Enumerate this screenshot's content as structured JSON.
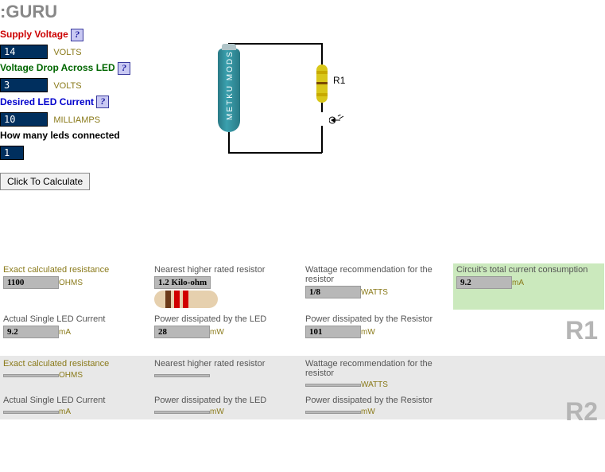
{
  "title": ":GURU",
  "inputs": {
    "supply_label": "Supply Voltage",
    "supply_value": "14",
    "supply_unit": "VOLTS",
    "vdrop_label": "Voltage Drop Across LED",
    "vdrop_value": "3",
    "vdrop_unit": "VOLTS",
    "current_label": "Desired LED Current",
    "current_value": "10",
    "current_unit": "MILLIAMPS",
    "count_label": "How many leds connected",
    "count_value": "1"
  },
  "calc_button": "Click To Calculate",
  "diagram": {
    "r1_label": "R1",
    "battery_text": "METKU MODS"
  },
  "results": {
    "r1": {
      "exact_label": "Exact calculated resistance",
      "exact_value": "1100",
      "exact_unit": "OHMS",
      "nearest_label": "Nearest higher rated resistor",
      "nearest_value": "1.2 Kilo-ohm",
      "watt_label": "Wattage recommendation for the resistor",
      "watt_value": "1/8",
      "watt_unit": "WATTS",
      "total_label": "Circuit's total current consumption",
      "total_value": "9.2",
      "total_unit": "mA",
      "actual_label": "Actual Single LED Current",
      "actual_value": "9.2",
      "actual_unit": "mA",
      "pled_label": "Power dissipated by the LED",
      "pled_value": "28",
      "pled_unit": "mW",
      "pres_label": "Power dissipated by the Resistor",
      "pres_value": "101",
      "pres_unit": "mW",
      "tag": "R1"
    },
    "r2": {
      "exact_label": "Exact calculated resistance",
      "exact_value": "",
      "exact_unit": "OHMS",
      "nearest_label": "Nearest higher rated resistor",
      "nearest_value": "",
      "watt_label": "Wattage recommendation for the resistor",
      "watt_value": "",
      "watt_unit": "WATTS",
      "actual_label": "Actual Single LED Current",
      "actual_value": "",
      "actual_unit": "mA",
      "pled_label": "Power dissipated by the LED",
      "pled_value": "",
      "pled_unit": "mW",
      "pres_label": "Power dissipated by the Resistor",
      "pres_value": "",
      "pres_unit": "mW",
      "tag": "R2"
    }
  },
  "help": "?"
}
